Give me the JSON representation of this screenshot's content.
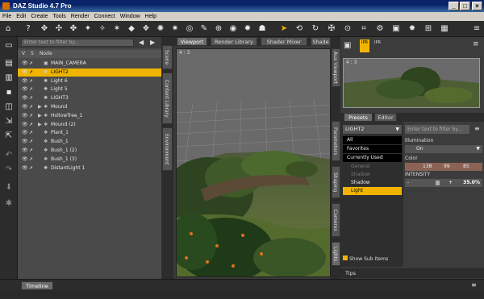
{
  "window": {
    "title": "DAZ Studio 4.7 Pro"
  },
  "menu": [
    "File",
    "Edit",
    "Create",
    "Tools",
    "Render",
    "Connect",
    "Window",
    "Help"
  ],
  "scene": {
    "filter_placeholder": "Enter text to filter by...",
    "columns": {
      "v": "V",
      "s": "S",
      "node": "Node"
    },
    "nodes": [
      {
        "label": "MAIN_CAMERA",
        "icon": "camera-icon",
        "expand": false,
        "selected": false
      },
      {
        "label": "LIGHT2",
        "icon": "light-icon",
        "expand": false,
        "selected": true
      },
      {
        "label": "Light 6",
        "icon": "light-icon",
        "expand": false,
        "selected": false
      },
      {
        "label": "Light 5",
        "icon": "light-icon",
        "expand": false,
        "selected": false
      },
      {
        "label": "LIGHT3",
        "icon": "light-icon",
        "expand": false,
        "selected": false
      },
      {
        "label": "Mound",
        "icon": "figure-icon",
        "expand": true,
        "selected": false
      },
      {
        "label": "HollowTree_1",
        "icon": "figure-icon",
        "expand": true,
        "selected": false
      },
      {
        "label": "Mound (2)",
        "icon": "figure-icon",
        "expand": true,
        "selected": false
      },
      {
        "label": "Plant_1",
        "icon": "figure-icon",
        "expand": false,
        "selected": false
      },
      {
        "label": "Bush_1",
        "icon": "figure-icon",
        "expand": false,
        "selected": false
      },
      {
        "label": "Bush_1 (2)",
        "icon": "figure-icon",
        "expand": false,
        "selected": false
      },
      {
        "label": "Bush_1 (3)",
        "icon": "figure-icon",
        "expand": false,
        "selected": false
      },
      {
        "label": "DistantLight 1",
        "icon": "light-icon",
        "expand": false,
        "selected": false
      }
    ]
  },
  "left_vertical_tabs": [
    "Scene",
    "Content Library",
    "Environment"
  ],
  "view_tabs": [
    "Viewport",
    "Render Library",
    "Shader Mixer",
    "Shade"
  ],
  "viewport": {
    "label": "4 : 3"
  },
  "right_vertical_tabs_top": [
    "Aux Viewport"
  ],
  "right_vertical_tabs_bottom": [
    "Parameters",
    "Shaping",
    "Cameras",
    "Lights"
  ],
  "aux": {
    "label": "4 : 3",
    "buttons": [
      "IPR",
      "IPR"
    ]
  },
  "param_tabs": [
    "Presets",
    "Editor"
  ],
  "presets": {
    "dropdown": "LIGHT2",
    "items": [
      "All",
      "Favorites",
      "Currently Used",
      "General",
      "Shadow",
      "Shadow",
      "Light"
    ],
    "show_sub_items": "Show Sub Items"
  },
  "properties": {
    "filter_placeholder": "Enter text to filter by...",
    "illumination_label": "Illumination",
    "illumination_value": "On",
    "color_label": "Color",
    "color_values": [
      "138",
      "99",
      "85"
    ],
    "color_swatch": "#8a6355",
    "intensity_label": "INTENSITY",
    "intensity_value": "35.0%",
    "intensity_fraction": 0.35
  },
  "tips": "Tips",
  "timeline": "Timeline",
  "colors": {
    "selection": "#f0b400",
    "panel": "#2c2c2c"
  }
}
